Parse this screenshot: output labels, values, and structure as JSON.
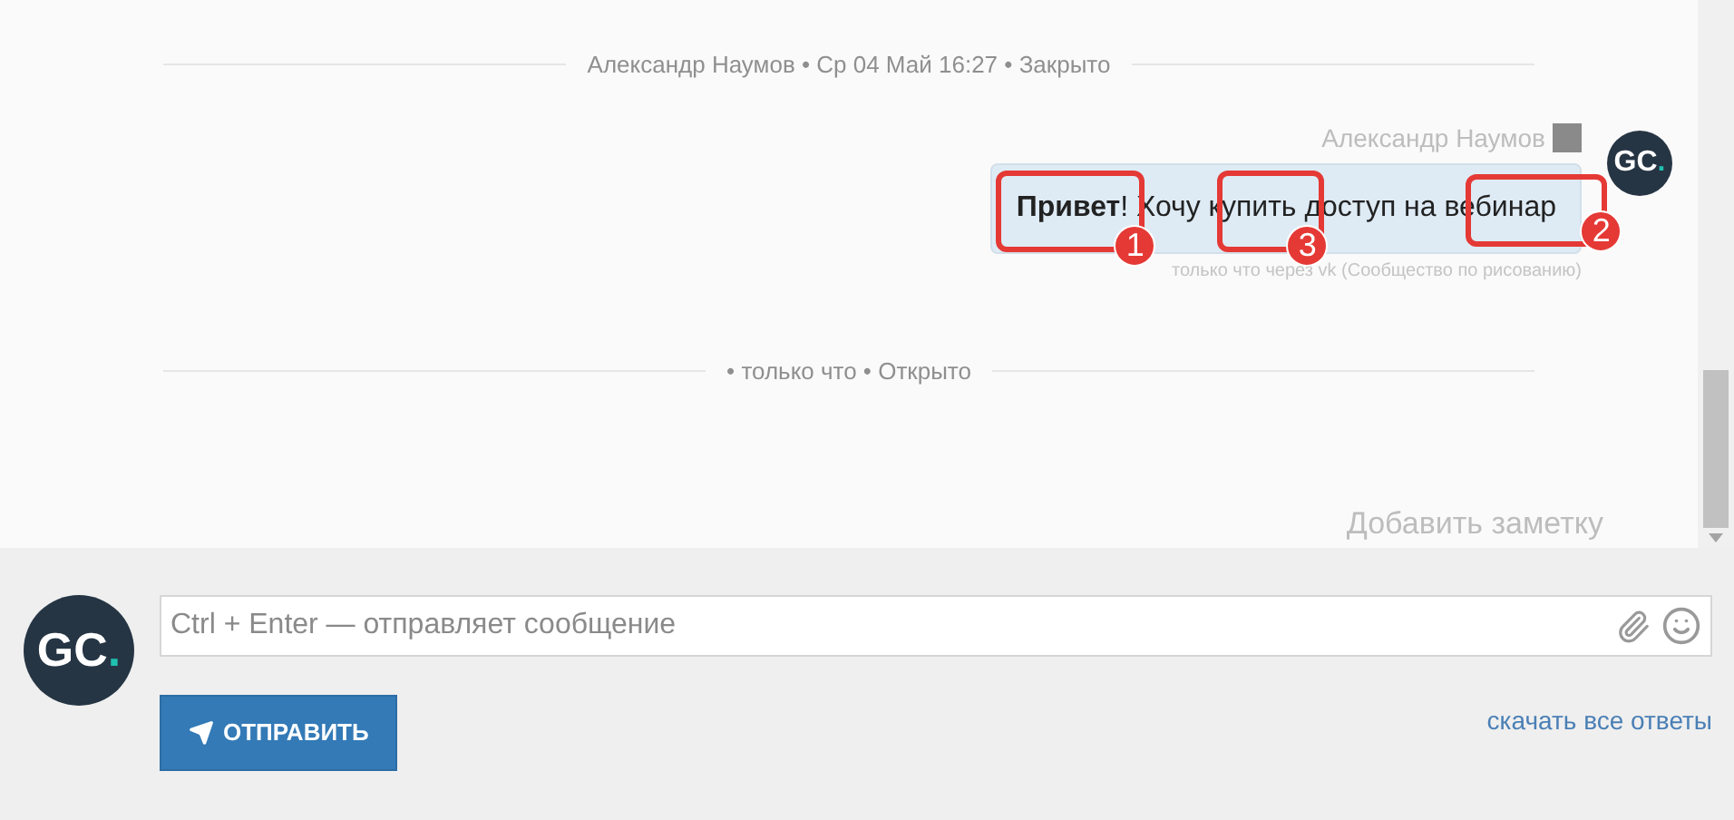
{
  "conversation": {
    "separators": [
      {
        "text": "Александр Наумов • Ср 04 Май 16:27 • Закрыто"
      }
    ],
    "message": {
      "author": "Александр Наумов",
      "text": "**Привет**! Хочу купить доступ на вебинар",
      "meta": "только что через vk (Сообщество по рисованию)",
      "avatar_text": "GC",
      "avatar_dot": "."
    },
    "annotations": [
      {
        "label": "1"
      },
      {
        "label": "3"
      },
      {
        "label": "2"
      }
    ],
    "status_separator": "• только что • Открыто",
    "add_note": "Добавить заметку"
  },
  "composer": {
    "avatar_text": "GC",
    "avatar_dot": ".",
    "placeholder": "Ctrl + Enter — отправляет сообщение",
    "send_button": "ОТПРАВИТЬ",
    "download_link": "скачать все ответы"
  }
}
